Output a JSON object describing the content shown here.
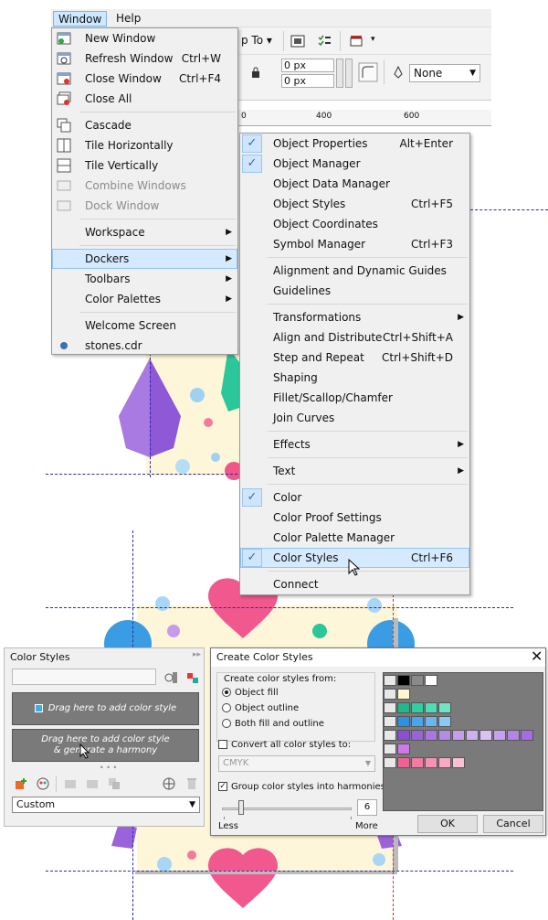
{
  "menubar": {
    "window": "Window",
    "help": "Help"
  },
  "toolbar": {
    "snap_to": "p To",
    "field1": "0 px",
    "field2": "0 px",
    "outline": "None"
  },
  "ruler": {
    "t400": "400",
    "t600": "600"
  },
  "window_menu": [
    {
      "label": "New Window",
      "shortcut": "",
      "icon": "new-window-icon"
    },
    {
      "label": "Refresh Window",
      "shortcut": "Ctrl+W",
      "icon": "refresh-window-icon"
    },
    {
      "label": "Close Window",
      "shortcut": "Ctrl+F4",
      "icon": "close-window-icon"
    },
    {
      "label": "Close All",
      "shortcut": "",
      "icon": "close-all-icon"
    },
    {
      "label": "Cascade",
      "icon": "cascade-icon"
    },
    {
      "label": "Tile Horizontally",
      "icon": "tile-horizontally-icon"
    },
    {
      "label": "Tile Vertically",
      "icon": "tile-vertically-icon"
    },
    {
      "label": "Combine Windows",
      "icon": "combine-windows-icon"
    },
    {
      "label": "Dock Window",
      "icon": "dock-window-icon"
    },
    {
      "label": "Workspace"
    },
    {
      "label": "Dockers"
    },
    {
      "label": "Toolbars"
    },
    {
      "label": "Color Palettes"
    },
    {
      "label": "Welcome Screen"
    },
    {
      "label": "stones.cdr",
      "icon": "document-icon"
    }
  ],
  "dockers_menu": [
    {
      "label": "Object Properties",
      "shortcut": "Alt+Enter"
    },
    {
      "label": "Object Manager",
      "shortcut": ""
    },
    {
      "label": "Object Data Manager",
      "shortcut": ""
    },
    {
      "label": "Object Styles",
      "shortcut": "Ctrl+F5"
    },
    {
      "label": "Object Coordinates",
      "shortcut": ""
    },
    {
      "label": "Symbol Manager",
      "shortcut": "Ctrl+F3"
    },
    {
      "label": "Alignment and Dynamic Guides",
      "shortcut": ""
    },
    {
      "label": "Guidelines",
      "shortcut": ""
    },
    {
      "label": "Transformations",
      "shortcut": ""
    },
    {
      "label": "Align and Distribute",
      "shortcut": "Ctrl+Shift+A"
    },
    {
      "label": "Step and Repeat",
      "shortcut": "Ctrl+Shift+D"
    },
    {
      "label": "Shaping",
      "shortcut": ""
    },
    {
      "label": "Fillet/Scallop/Chamfer",
      "shortcut": ""
    },
    {
      "label": "Join Curves",
      "shortcut": ""
    },
    {
      "label": "Effects",
      "shortcut": ""
    },
    {
      "label": "Text",
      "shortcut": ""
    },
    {
      "label": "Color",
      "shortcut": ""
    },
    {
      "label": "Color Proof Settings",
      "shortcut": ""
    },
    {
      "label": "Color Palette Manager",
      "shortcut": ""
    },
    {
      "label": "Color Styles",
      "shortcut": "Ctrl+F6"
    },
    {
      "label": "Connect",
      "shortcut": ""
    }
  ],
  "color_styles_panel": {
    "title": "Color Styles",
    "drop1": "Drag here to add color style",
    "drop2a": "Drag here to add color style",
    "drop2b": "& generate a harmony",
    "dropdown": "Custom"
  },
  "dialog": {
    "title": "Create Color Styles",
    "group_label": "Create color styles from:",
    "opt_fill": "Object fill",
    "opt_outline": "Object outline",
    "opt_both": "Both fill and outline",
    "convert_label": "Convert all color styles to:",
    "convert_value": "CMYK",
    "group_harmonies": "Group color styles into harmonies:",
    "slider_value": "6",
    "less": "Less",
    "more": "More",
    "ok": "OK",
    "cancel": "Cancel"
  },
  "colors": {
    "accent": "#3b7fd4",
    "menu_bg": "#f0f0f0",
    "highlight": "#d6eaff"
  },
  "swatch_rows": [
    [
      "#000000",
      "#8a8a8a",
      "#ffffff"
    ],
    [
      "#fff7d0"
    ],
    [
      "#1fb98a",
      "#2fcfa2",
      "#4fdcb6",
      "#6fe5c6"
    ],
    [
      "#2f8fe0",
      "#4aa6ec",
      "#6ab7f0",
      "#8ac8f5"
    ],
    [
      "#8a4fd4",
      "#9a63da",
      "#a877e0",
      "#b58be6",
      "#c29eeb",
      "#ceb1f0",
      "#d9c3f4",
      "#c8a0ef",
      "#b584e9",
      "#a66ce3"
    ],
    [
      "#cc7ae8"
    ],
    [
      "#f06292",
      "#f47aa3",
      "#f792b4",
      "#f9a9c4",
      "#fbc0d4"
    ]
  ]
}
